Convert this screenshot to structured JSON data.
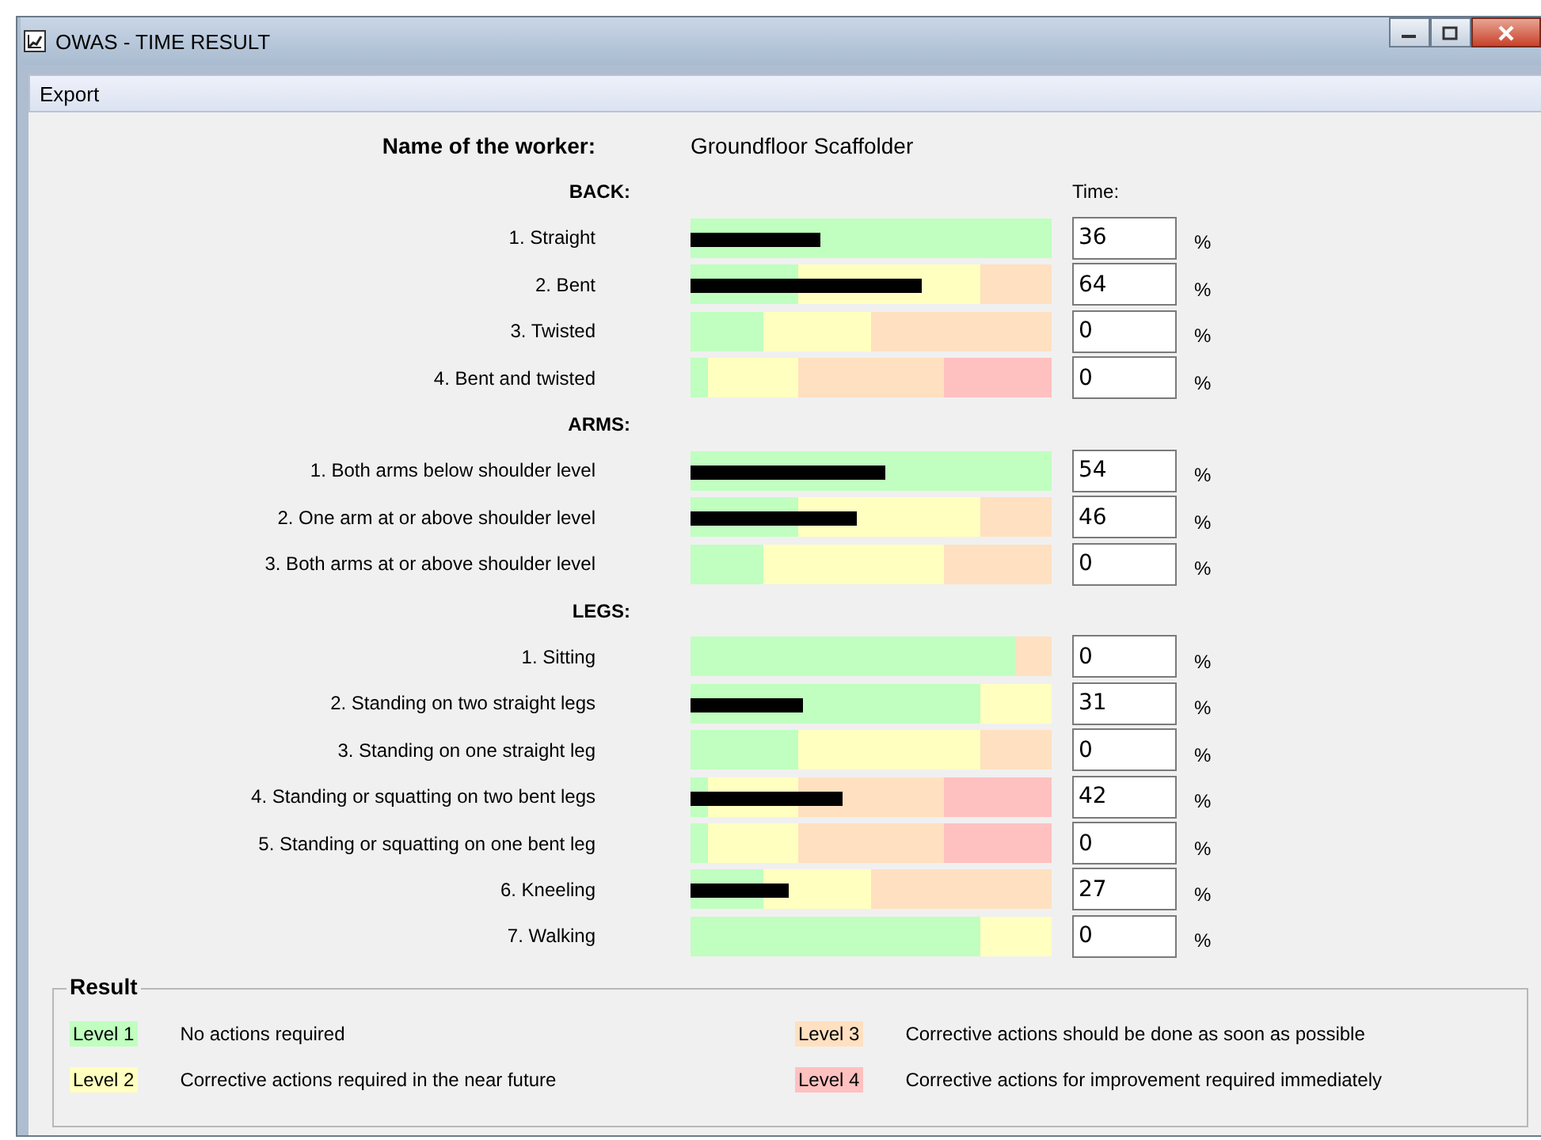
{
  "window": {
    "title": "OWAS - TIME RESULT"
  },
  "menu": [
    "Export"
  ],
  "worker": {
    "label": "Name of the worker:",
    "value": "Groundfloor Scaffolder"
  },
  "time_heading": "Time:",
  "sections": [
    {
      "title": "BACK:",
      "rows": [
        {
          "label": "1. Straight",
          "value": "36",
          "unit": "%",
          "zones": [
            {
              "color": "#c0ffc0"
            },
            {
              "color": "#c0ffc0"
            },
            {
              "color": "#c0ffc0"
            },
            {
              "color": "#c0ffc0"
            },
            {
              "color": "#c0ffc0"
            },
            {
              "color": "#c0ffc0"
            },
            {
              "color": "#c0ffc0"
            },
            {
              "color": "#c0ffc0"
            },
            {
              "color": "#c0ffc0"
            },
            {
              "color": "#c0ffc0"
            },
            {
              "color": "#c0ffc0"
            },
            {
              "color": "#c0ffc0"
            },
            {
              "color": "#c0ffc0"
            },
            {
              "color": "#c0ffc0"
            },
            {
              "color": "#c0ffc0"
            },
            {
              "color": "#c0ffc0"
            },
            {
              "color": "#c0ffc0"
            },
            {
              "color": "#c0ffc0"
            },
            {
              "color": "#c0ffc0"
            },
            {
              "color": "#c0ffc0"
            }
          ]
        },
        {
          "label": "2. Bent",
          "value": "64",
          "unit": "%",
          "zones": [
            {
              "color": "#c0ffc0"
            },
            {
              "color": "#c0ffc0"
            },
            {
              "color": "#c0ffc0"
            },
            {
              "color": "#c0ffc0"
            },
            {
              "color": "#c0ffc0"
            },
            {
              "color": "#c0ffc0"
            },
            {
              "color": "#ffffc0"
            },
            {
              "color": "#ffffc0"
            },
            {
              "color": "#ffffc0"
            },
            {
              "color": "#ffffc0"
            },
            {
              "color": "#ffffc0"
            },
            {
              "color": "#ffffc0"
            },
            {
              "color": "#ffffc0"
            },
            {
              "color": "#ffffc0"
            },
            {
              "color": "#ffffc0"
            },
            {
              "color": "#ffffc0"
            },
            {
              "color": "#ffe0c0"
            },
            {
              "color": "#ffe0c0"
            },
            {
              "color": "#ffe0c0"
            },
            {
              "color": "#ffe0c0"
            }
          ]
        },
        {
          "label": "3. Twisted",
          "value": "0",
          "unit": "%",
          "zones": [
            {
              "color": "#c0ffc0"
            },
            {
              "color": "#c0ffc0"
            },
            {
              "color": "#c0ffc0"
            },
            {
              "color": "#c0ffc0"
            },
            {
              "color": "#ffffc0"
            },
            {
              "color": "#ffffc0"
            },
            {
              "color": "#ffffc0"
            },
            {
              "color": "#ffffc0"
            },
            {
              "color": "#ffffc0"
            },
            {
              "color": "#ffffc0"
            },
            {
              "color": "#ffe0c0"
            },
            {
              "color": "#ffe0c0"
            },
            {
              "color": "#ffe0c0"
            },
            {
              "color": "#ffe0c0"
            },
            {
              "color": "#ffe0c0"
            },
            {
              "color": "#ffe0c0"
            },
            {
              "color": "#ffe0c0"
            },
            {
              "color": "#ffe0c0"
            },
            {
              "color": "#ffe0c0"
            },
            {
              "color": "#ffe0c0"
            }
          ]
        },
        {
          "label": "4. Bent and twisted",
          "value": "0",
          "unit": "%",
          "zones": [
            {
              "color": "#c0ffc0"
            },
            {
              "color": "#ffffc0"
            },
            {
              "color": "#ffffc0"
            },
            {
              "color": "#ffffc0"
            },
            {
              "color": "#ffffc0"
            },
            {
              "color": "#ffffc0"
            },
            {
              "color": "#ffe0c0"
            },
            {
              "color": "#ffe0c0"
            },
            {
              "color": "#ffe0c0"
            },
            {
              "color": "#ffe0c0"
            },
            {
              "color": "#ffe0c0"
            },
            {
              "color": "#ffe0c0"
            },
            {
              "color": "#ffe0c0"
            },
            {
              "color": "#ffe0c0"
            },
            {
              "color": "#ffc0c0"
            },
            {
              "color": "#ffc0c0"
            },
            {
              "color": "#ffc0c0"
            },
            {
              "color": "#ffc0c0"
            },
            {
              "color": "#ffc0c0"
            },
            {
              "color": "#ffc0c0"
            }
          ]
        }
      ]
    },
    {
      "title": "ARMS:",
      "rows": [
        {
          "label": "1. Both arms below shoulder level",
          "value": "54",
          "unit": "%",
          "zones": [
            {
              "color": "#c0ffc0"
            },
            {
              "color": "#c0ffc0"
            },
            {
              "color": "#c0ffc0"
            },
            {
              "color": "#c0ffc0"
            },
            {
              "color": "#c0ffc0"
            },
            {
              "color": "#c0ffc0"
            },
            {
              "color": "#c0ffc0"
            },
            {
              "color": "#c0ffc0"
            },
            {
              "color": "#c0ffc0"
            },
            {
              "color": "#c0ffc0"
            },
            {
              "color": "#c0ffc0"
            },
            {
              "color": "#c0ffc0"
            },
            {
              "color": "#c0ffc0"
            },
            {
              "color": "#c0ffc0"
            },
            {
              "color": "#c0ffc0"
            },
            {
              "color": "#c0ffc0"
            },
            {
              "color": "#c0ffc0"
            },
            {
              "color": "#c0ffc0"
            },
            {
              "color": "#c0ffc0"
            },
            {
              "color": "#c0ffc0"
            }
          ]
        },
        {
          "label": "2. One arm at or above shoulder level",
          "value": "46",
          "unit": "%",
          "zones": [
            {
              "color": "#c0ffc0"
            },
            {
              "color": "#c0ffc0"
            },
            {
              "color": "#c0ffc0"
            },
            {
              "color": "#c0ffc0"
            },
            {
              "color": "#c0ffc0"
            },
            {
              "color": "#c0ffc0"
            },
            {
              "color": "#ffffc0"
            },
            {
              "color": "#ffffc0"
            },
            {
              "color": "#ffffc0"
            },
            {
              "color": "#ffffc0"
            },
            {
              "color": "#ffffc0"
            },
            {
              "color": "#ffffc0"
            },
            {
              "color": "#ffffc0"
            },
            {
              "color": "#ffffc0"
            },
            {
              "color": "#ffffc0"
            },
            {
              "color": "#ffffc0"
            },
            {
              "color": "#ffe0c0"
            },
            {
              "color": "#ffe0c0"
            },
            {
              "color": "#ffe0c0"
            },
            {
              "color": "#ffe0c0"
            }
          ]
        },
        {
          "label": "3. Both arms at or above shoulder level",
          "value": "0",
          "unit": "%",
          "zones": [
            {
              "color": "#c0ffc0"
            },
            {
              "color": "#c0ffc0"
            },
            {
              "color": "#c0ffc0"
            },
            {
              "color": "#c0ffc0"
            },
            {
              "color": "#ffffc0"
            },
            {
              "color": "#ffffc0"
            },
            {
              "color": "#ffffc0"
            },
            {
              "color": "#ffffc0"
            },
            {
              "color": "#ffffc0"
            },
            {
              "color": "#ffffc0"
            },
            {
              "color": "#ffffc0"
            },
            {
              "color": "#ffffc0"
            },
            {
              "color": "#ffffc0"
            },
            {
              "color": "#ffffc0"
            },
            {
              "color": "#ffe0c0"
            },
            {
              "color": "#ffe0c0"
            },
            {
              "color": "#ffe0c0"
            },
            {
              "color": "#ffe0c0"
            },
            {
              "color": "#ffe0c0"
            },
            {
              "color": "#ffe0c0"
            }
          ]
        }
      ]
    },
    {
      "title": "LEGS:",
      "rows": [
        {
          "label": "1. Sitting",
          "value": "0",
          "unit": "%",
          "zones": [
            {
              "color": "#c0ffc0"
            },
            {
              "color": "#c0ffc0"
            },
            {
              "color": "#c0ffc0"
            },
            {
              "color": "#c0ffc0"
            },
            {
              "color": "#c0ffc0"
            },
            {
              "color": "#c0ffc0"
            },
            {
              "color": "#c0ffc0"
            },
            {
              "color": "#c0ffc0"
            },
            {
              "color": "#c0ffc0"
            },
            {
              "color": "#c0ffc0"
            },
            {
              "color": "#c0ffc0"
            },
            {
              "color": "#c0ffc0"
            },
            {
              "color": "#c0ffc0"
            },
            {
              "color": "#c0ffc0"
            },
            {
              "color": "#c0ffc0"
            },
            {
              "color": "#c0ffc0"
            },
            {
              "color": "#c0ffc0"
            },
            {
              "color": "#c0ffc0"
            },
            {
              "color": "#ffe0c0"
            },
            {
              "color": "#ffe0c0"
            }
          ]
        },
        {
          "label": "2. Standing on two straight legs",
          "value": "31",
          "unit": "%",
          "zones": [
            {
              "color": "#c0ffc0"
            },
            {
              "color": "#c0ffc0"
            },
            {
              "color": "#c0ffc0"
            },
            {
              "color": "#c0ffc0"
            },
            {
              "color": "#c0ffc0"
            },
            {
              "color": "#c0ffc0"
            },
            {
              "color": "#c0ffc0"
            },
            {
              "color": "#c0ffc0"
            },
            {
              "color": "#c0ffc0"
            },
            {
              "color": "#c0ffc0"
            },
            {
              "color": "#c0ffc0"
            },
            {
              "color": "#c0ffc0"
            },
            {
              "color": "#c0ffc0"
            },
            {
              "color": "#c0ffc0"
            },
            {
              "color": "#c0ffc0"
            },
            {
              "color": "#c0ffc0"
            },
            {
              "color": "#ffffc0"
            },
            {
              "color": "#ffffc0"
            },
            {
              "color": "#ffffc0"
            },
            {
              "color": "#ffffc0"
            }
          ]
        },
        {
          "label": "3. Standing on one straight leg",
          "value": "0",
          "unit": "%",
          "zones": [
            {
              "color": "#c0ffc0"
            },
            {
              "color": "#c0ffc0"
            },
            {
              "color": "#c0ffc0"
            },
            {
              "color": "#c0ffc0"
            },
            {
              "color": "#c0ffc0"
            },
            {
              "color": "#c0ffc0"
            },
            {
              "color": "#ffffc0"
            },
            {
              "color": "#ffffc0"
            },
            {
              "color": "#ffffc0"
            },
            {
              "color": "#ffffc0"
            },
            {
              "color": "#ffffc0"
            },
            {
              "color": "#ffffc0"
            },
            {
              "color": "#ffffc0"
            },
            {
              "color": "#ffffc0"
            },
            {
              "color": "#ffffc0"
            },
            {
              "color": "#ffffc0"
            },
            {
              "color": "#ffe0c0"
            },
            {
              "color": "#ffe0c0"
            },
            {
              "color": "#ffe0c0"
            },
            {
              "color": "#ffe0c0"
            }
          ]
        },
        {
          "label": "4. Standing or squatting on two bent legs",
          "value": "42",
          "unit": "%",
          "zones": [
            {
              "color": "#c0ffc0"
            },
            {
              "color": "#ffffc0"
            },
            {
              "color": "#ffffc0"
            },
            {
              "color": "#ffffc0"
            },
            {
              "color": "#ffffc0"
            },
            {
              "color": "#ffffc0"
            },
            {
              "color": "#ffe0c0"
            },
            {
              "color": "#ffe0c0"
            },
            {
              "color": "#ffe0c0"
            },
            {
              "color": "#ffe0c0"
            },
            {
              "color": "#ffe0c0"
            },
            {
              "color": "#ffe0c0"
            },
            {
              "color": "#ffe0c0"
            },
            {
              "color": "#ffe0c0"
            },
            {
              "color": "#ffc0c0"
            },
            {
              "color": "#ffc0c0"
            },
            {
              "color": "#ffc0c0"
            },
            {
              "color": "#ffc0c0"
            },
            {
              "color": "#ffc0c0"
            },
            {
              "color": "#ffc0c0"
            }
          ]
        },
        {
          "label": "5. Standing or squatting on one bent leg",
          "value": "0",
          "unit": "%",
          "zones": [
            {
              "color": "#c0ffc0"
            },
            {
              "color": "#ffffc0"
            },
            {
              "color": "#ffffc0"
            },
            {
              "color": "#ffffc0"
            },
            {
              "color": "#ffffc0"
            },
            {
              "color": "#ffffc0"
            },
            {
              "color": "#ffe0c0"
            },
            {
              "color": "#ffe0c0"
            },
            {
              "color": "#ffe0c0"
            },
            {
              "color": "#ffe0c0"
            },
            {
              "color": "#ffe0c0"
            },
            {
              "color": "#ffe0c0"
            },
            {
              "color": "#ffe0c0"
            },
            {
              "color": "#ffe0c0"
            },
            {
              "color": "#ffc0c0"
            },
            {
              "color": "#ffc0c0"
            },
            {
              "color": "#ffc0c0"
            },
            {
              "color": "#ffc0c0"
            },
            {
              "color": "#ffc0c0"
            },
            {
              "color": "#ffc0c0"
            }
          ]
        },
        {
          "label": "6. Kneeling",
          "value": "27",
          "unit": "%",
          "zones": [
            {
              "color": "#c0ffc0"
            },
            {
              "color": "#c0ffc0"
            },
            {
              "color": "#c0ffc0"
            },
            {
              "color": "#c0ffc0"
            },
            {
              "color": "#ffffc0"
            },
            {
              "color": "#ffffc0"
            },
            {
              "color": "#ffffc0"
            },
            {
              "color": "#ffffc0"
            },
            {
              "color": "#ffffc0"
            },
            {
              "color": "#ffffc0"
            },
            {
              "color": "#ffe0c0"
            },
            {
              "color": "#ffe0c0"
            },
            {
              "color": "#ffe0c0"
            },
            {
              "color": "#ffe0c0"
            },
            {
              "color": "#ffe0c0"
            },
            {
              "color": "#ffe0c0"
            },
            {
              "color": "#ffe0c0"
            },
            {
              "color": "#ffe0c0"
            },
            {
              "color": "#ffe0c0"
            },
            {
              "color": "#ffe0c0"
            }
          ]
        },
        {
          "label": "7. Walking",
          "value": "0",
          "unit": "%",
          "zones": [
            {
              "color": "#c0ffc0"
            },
            {
              "color": "#c0ffc0"
            },
            {
              "color": "#c0ffc0"
            },
            {
              "color": "#c0ffc0"
            },
            {
              "color": "#c0ffc0"
            },
            {
              "color": "#c0ffc0"
            },
            {
              "color": "#c0ffc0"
            },
            {
              "color": "#c0ffc0"
            },
            {
              "color": "#c0ffc0"
            },
            {
              "color": "#c0ffc0"
            },
            {
              "color": "#c0ffc0"
            },
            {
              "color": "#c0ffc0"
            },
            {
              "color": "#c0ffc0"
            },
            {
              "color": "#c0ffc0"
            },
            {
              "color": "#c0ffc0"
            },
            {
              "color": "#c0ffc0"
            },
            {
              "color": "#ffffc0"
            },
            {
              "color": "#ffffc0"
            },
            {
              "color": "#ffffc0"
            },
            {
              "color": "#ffffc0"
            }
          ]
        }
      ]
    }
  ],
  "result": {
    "title": "Result",
    "levels": [
      {
        "name": "Level 1",
        "color": "#c0ffc0",
        "description": "No actions required"
      },
      {
        "name": "Level 3",
        "color": "#ffe0c0",
        "description": "Corrective actions should be done as soon as possible"
      },
      {
        "name": "Level 2",
        "color": "#ffffc0",
        "description": "Corrective actions required in the near future"
      },
      {
        "name": "Level 4",
        "color": "#ffc0c0",
        "description": "Corrective actions for improvement required immediately"
      }
    ]
  }
}
